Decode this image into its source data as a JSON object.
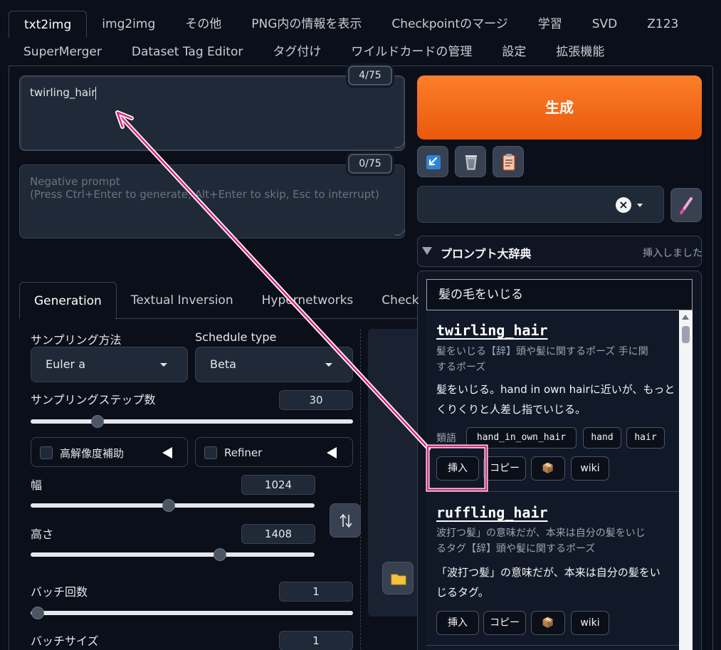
{
  "top_tabs_row1": [
    "txt2img",
    "img2img",
    "その他",
    "PNG内の情報を表示",
    "Checkpointのマージ",
    "学習",
    "SVD",
    "Z123"
  ],
  "top_tabs_row2": [
    "SuperMerger",
    "Dataset Tag Editor",
    "タグ付け",
    "ワイルドカードの管理",
    "設定",
    "拡張機能"
  ],
  "prompt": {
    "value": "twirling_hair",
    "counter": "4/75"
  },
  "negative_prompt": {
    "placeholder_line1": "Negative prompt",
    "placeholder_line2": "(Press Ctrl+Enter to generate, Alt+Enter to skip, Esc to interrupt)",
    "counter": "0/75"
  },
  "generate_label": "生成",
  "style_clear_symbol": "×",
  "dictionary": {
    "title": "プロンプト大辞典",
    "status": "挿入しました",
    "search_value": "髪の毛をいじる",
    "entries": [
      {
        "tag": "twirling_hair",
        "category_line1": "髪をいじる【辞】頭や髪に関するポーズ 手に関",
        "category_line2": "するポーズ",
        "desc_line1": "髪をいじる。hand in own hairに近いが、もっと",
        "desc_line2": "くりくりと人差し指でいじる。",
        "synonyms_label": "類語",
        "synonyms": [
          "hand_in_own_hair",
          "hand",
          "hair"
        ],
        "actions": [
          "挿入",
          "コピー",
          "📦",
          "wiki"
        ]
      },
      {
        "tag": "ruffling_hair",
        "category_line1": "波打つ髪」の意味だが、本来は自分の髪をいじ",
        "category_line2": "るタグ【辞】頭や髪に関するポーズ",
        "desc_line1": "「波打つ髪」の意味だが、本来は自分の髪をい",
        "desc_line2": "じるタグ。",
        "actions": [
          "挿入",
          "コピー",
          "📦",
          "wiki"
        ]
      }
    ]
  },
  "sub_tabs": [
    "Generation",
    "Textual Inversion",
    "Hypernetworks",
    "Check"
  ],
  "sampler": {
    "label": "サンプリング方法",
    "value": "Euler a"
  },
  "schedule": {
    "label": "Schedule type",
    "value": "Beta"
  },
  "steps": {
    "label": "サンプリングステップ数",
    "value": "30",
    "fraction": 0.2
  },
  "hires": {
    "label": "高解像度補助"
  },
  "refiner": {
    "label": "Refiner"
  },
  "width": {
    "label": "幅",
    "value": "1024",
    "fraction": 0.48
  },
  "height": {
    "label": "高さ",
    "value": "1408",
    "fraction": 0.67
  },
  "batch_count": {
    "label": "バッチ回数",
    "value": "1",
    "fraction": 0.0
  },
  "batch_size": {
    "label": "バッチサイズ",
    "value": "1"
  },
  "colors": {
    "accent_orange": "#f97316",
    "annotation": "#e0257a"
  }
}
